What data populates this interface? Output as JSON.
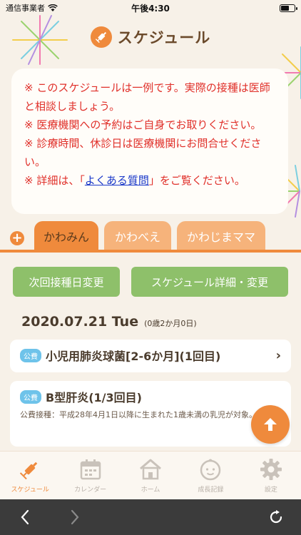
{
  "status_bar": {
    "carrier": "通信事業者",
    "time": "午後4:30"
  },
  "header": {
    "title": "スケジュール"
  },
  "notice": {
    "lines": [
      "※ このスケジュールは一例です。実際の接種は医師と相談しましょう。",
      "※ 医療機関への予約はご自身でお取りください。",
      "※ 診療時間、休診日は医療機関にお問合せください。"
    ],
    "faq_prefix": "※ 詳細は、「",
    "faq_link": "よくある質問",
    "faq_suffix": "」をご覧ください。"
  },
  "tabs": [
    "かわみん",
    "かわべえ",
    "かわじまママ"
  ],
  "buttons": {
    "change_next_date": "次回接種日変更",
    "schedule_detail": "スケジュール詳細・変更"
  },
  "date": {
    "main": "2020.07.21 Tue",
    "age": "(0歳2か月0日)"
  },
  "vaccines": [
    {
      "badge": "公費",
      "name": "小児用肺炎球菌[2-6か月](1回目)"
    },
    {
      "badge": "公費",
      "name": "B型肝炎(1/3回目)",
      "note": "公費接種：平成28年4月1日以降に生まれた1歳未満の乳児が対象。"
    }
  ],
  "bottom_tabs": [
    "スケジュール",
    "カレンダー",
    "ホーム",
    "成長記録",
    "設定"
  ],
  "colors": {
    "accent": "#ef8a3c",
    "green": "#8ec06a",
    "badge": "#6ec3ea",
    "notice_text": "#e0302a"
  }
}
